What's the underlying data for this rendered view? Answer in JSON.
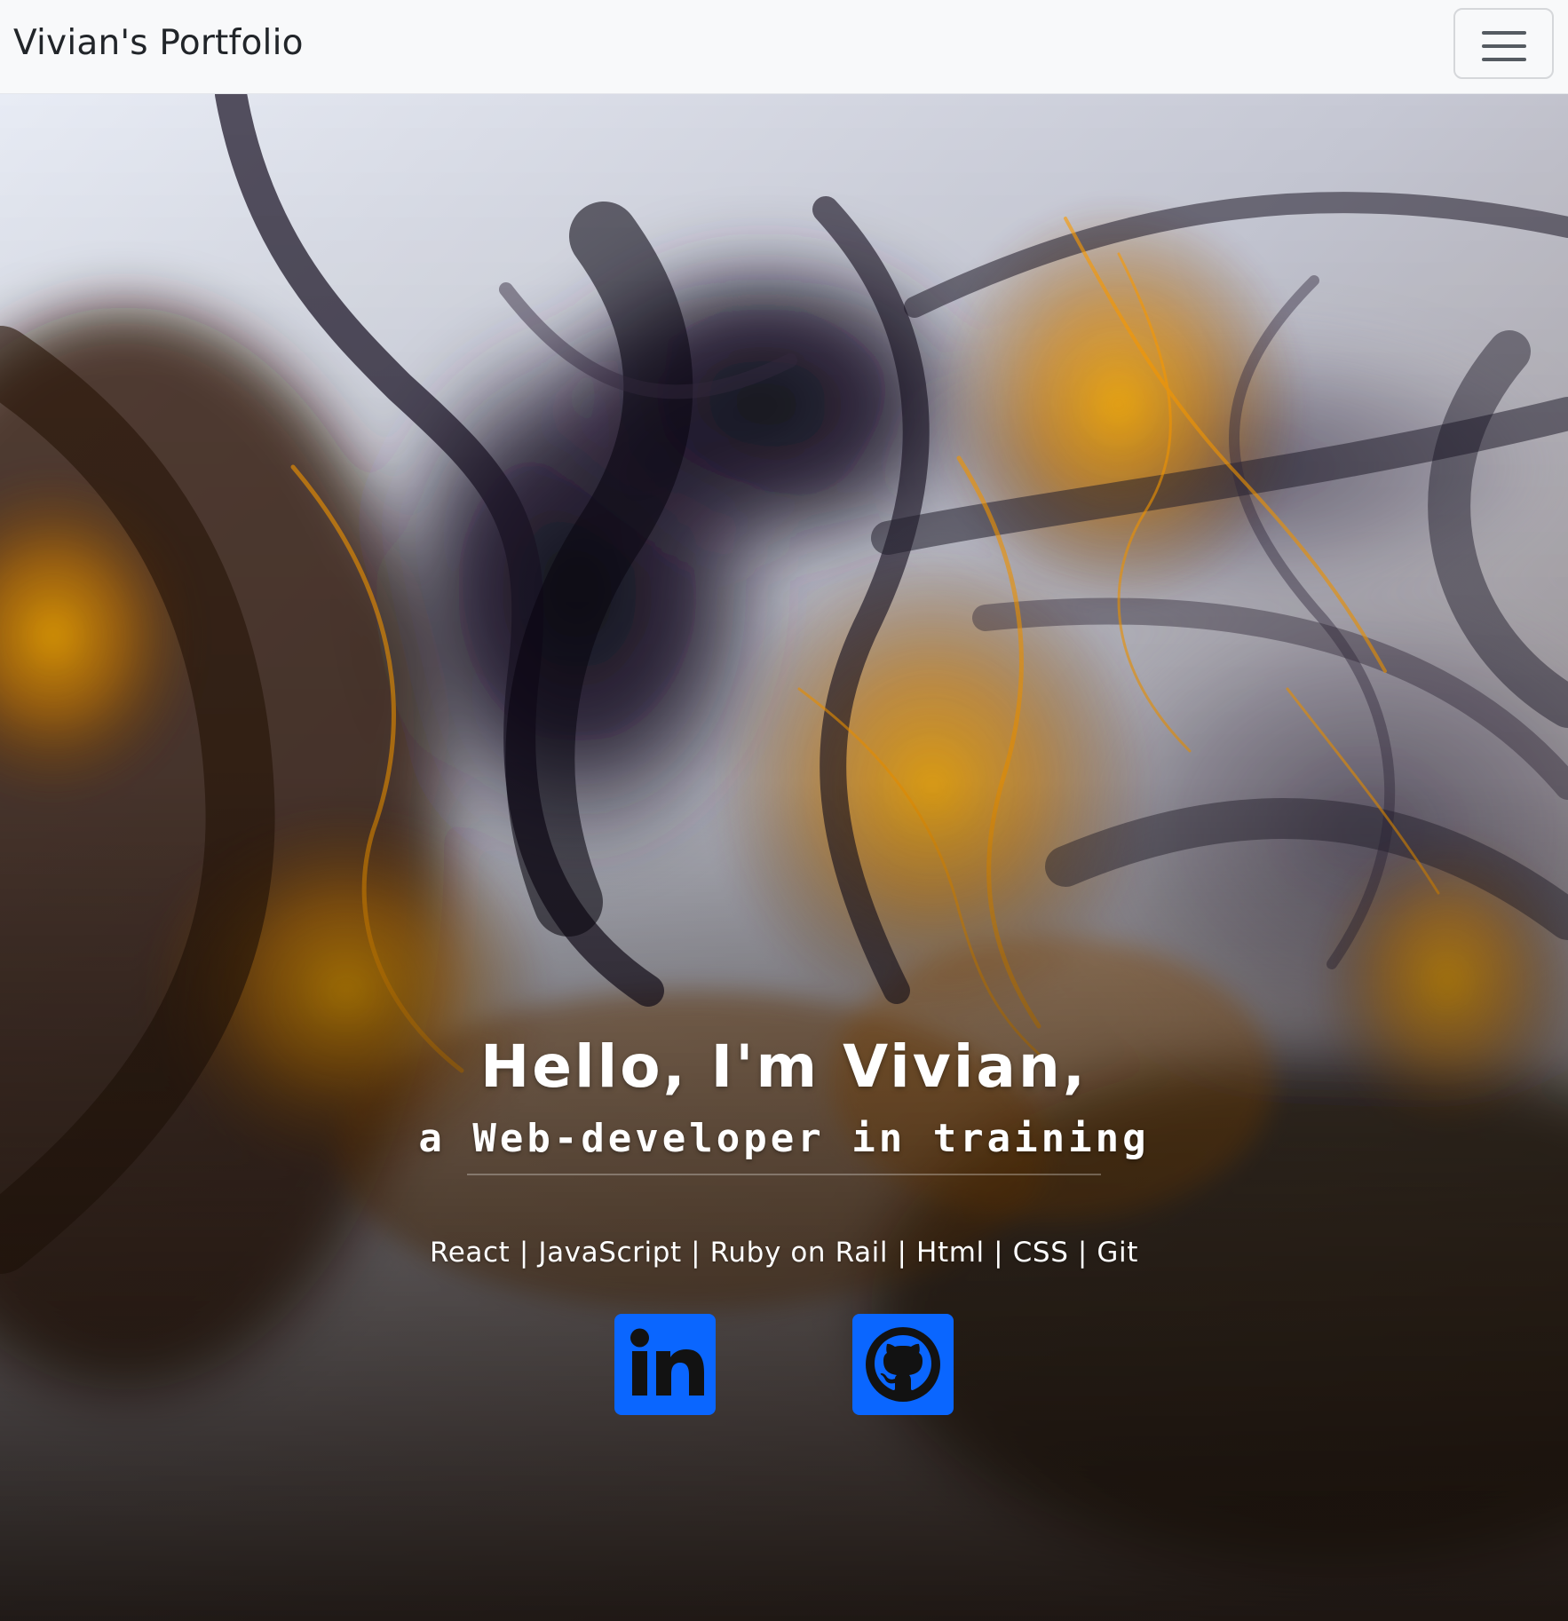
{
  "colors": {
    "navbar_background": "#f8f9fa",
    "brand_text": "#212529",
    "hero_text": "#ffffff",
    "social_icon": "#0a66ff",
    "ink_orange": "#d98a00",
    "ink_dark": "#1a1022"
  },
  "navbar": {
    "brand": "Vivian's Portfolio",
    "menu_icon": "hamburger-icon"
  },
  "hero": {
    "headline": "Hello, I'm Vivian,",
    "subheadline": "a Web-developer in training",
    "skills": "React | JavaScript | Ruby on Rail | Html | CSS | Git",
    "background": "abstract dark violet and orange ink clouds"
  },
  "social_links": [
    {
      "icon": "linkedin-icon"
    },
    {
      "icon": "github-icon"
    }
  ]
}
